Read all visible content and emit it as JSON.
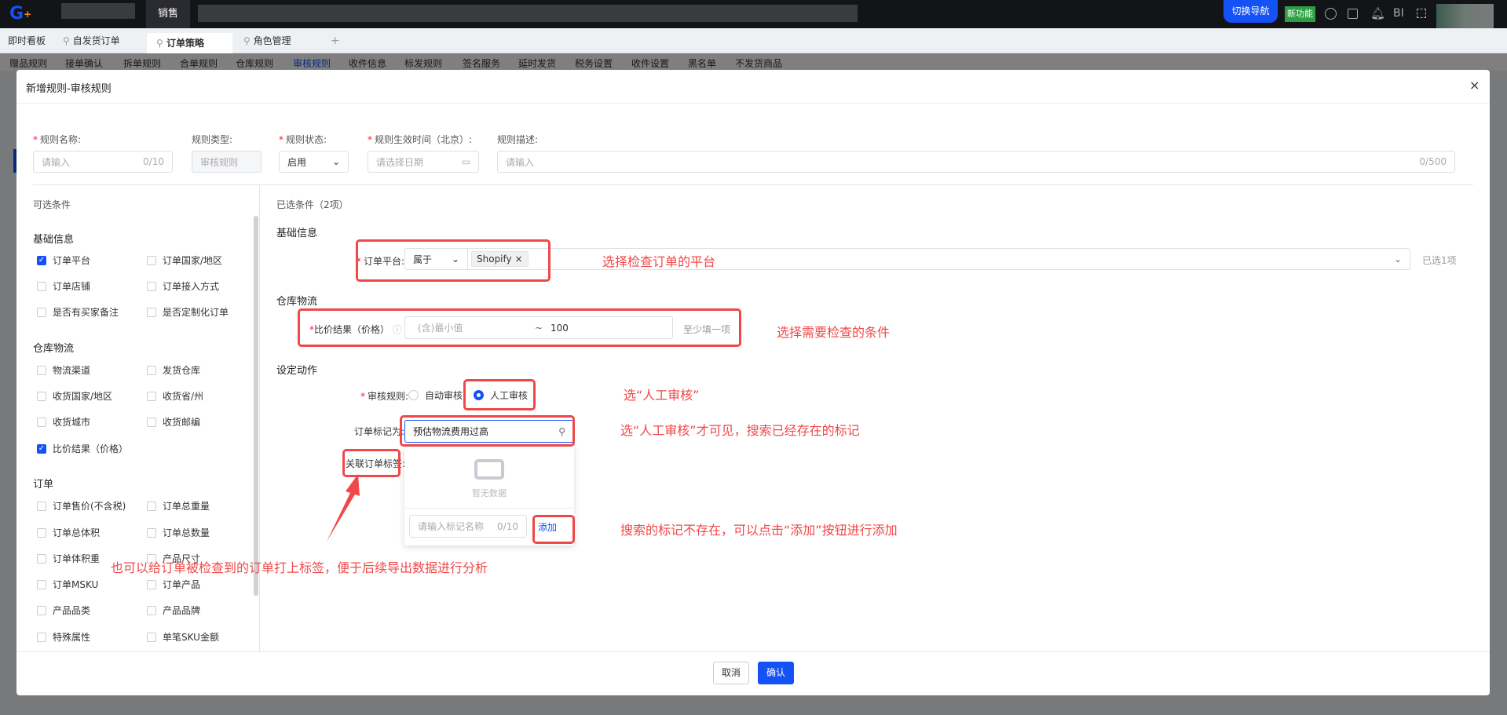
{
  "topbar": {
    "active_menu": "销售",
    "switch_nav": "切换导航",
    "new_feature": "新功能",
    "bi": "BI",
    "colors": {
      "bg": "#131418",
      "primary": "#1452f5",
      "green": "#2ea043"
    }
  },
  "tabs": [
    {
      "label": "即时看板"
    },
    {
      "label": "自发货订单"
    },
    {
      "label": "订单策略",
      "active": true
    },
    {
      "label": "角色管理"
    }
  ],
  "tab_add": "+",
  "subnav": [
    "赠品规则",
    "接单确认",
    "拆单规则",
    "合单规则",
    "仓库规则",
    "审核规则",
    "收件信息",
    "标发规则",
    "签名服务",
    "延时发货",
    "税务设置",
    "收件设置",
    "黑名单",
    "不发货商品"
  ],
  "modal": {
    "title": "新增规则-审核规则",
    "form": {
      "name_label": "规则名称:",
      "name_placeholder": "请输入",
      "name_count": "0/10",
      "type_label": "规则类型:",
      "type_value": "审核规则",
      "status_label": "规则状态:",
      "status_value": "启用",
      "time_label": "规则生效时间（北京）:",
      "time_placeholder": "请选择日期",
      "desc_label": "规则描述:",
      "desc_placeholder": "请输入",
      "desc_count": "0/500"
    },
    "left": {
      "title": "可选条件",
      "groups": [
        {
          "title": "基础信息",
          "items": [
            {
              "label": "订单平台",
              "checked": true
            },
            {
              "label": "订单国家/地区"
            },
            {
              "label": "订单店铺"
            },
            {
              "label": "订单接入方式"
            },
            {
              "label": "是否有买家备注"
            },
            {
              "label": "是否定制化订单"
            }
          ]
        },
        {
          "title": "仓库物流",
          "items": [
            {
              "label": "物流渠道"
            },
            {
              "label": "发货仓库"
            },
            {
              "label": "收货国家/地区"
            },
            {
              "label": "收货省/州"
            },
            {
              "label": "收货城市"
            },
            {
              "label": "收货邮编"
            },
            {
              "label": "比价结果（价格）",
              "checked": true
            }
          ]
        },
        {
          "title": "订单",
          "items": [
            {
              "label": "订单售价(不含税)"
            },
            {
              "label": "订单总重量"
            },
            {
              "label": "订单总体积"
            },
            {
              "label": "订单总数量"
            },
            {
              "label": "订单体积重"
            },
            {
              "label": "产品尺寸"
            },
            {
              "label": "订单MSKU"
            },
            {
              "label": "订单产品"
            },
            {
              "label": "产品品类"
            },
            {
              "label": "产品品牌"
            },
            {
              "label": "特殊属性"
            },
            {
              "label": "单笔SKU金额"
            }
          ]
        }
      ]
    },
    "right": {
      "title": "已选条件（2项）",
      "basic_title": "基础信息",
      "platform_label": "订单平台:",
      "platform_op": "属于",
      "platform_tag": "Shopify",
      "platform_selected": "已选1项",
      "wh_title": "仓库物流",
      "price_label": "比价结果（价格）",
      "price_min_placeholder": "(含)最小值",
      "price_sep": "~",
      "price_max": "100",
      "price_hint": "至少填一项",
      "action_title": "设定动作",
      "review_label": "审核规则:",
      "review_auto": "自动审核",
      "review_manual": "人工审核",
      "review_selected": "人工审核",
      "mark_label": "订单标记为:",
      "mark_value": "预估物流费用过高",
      "empty_text": "暂无数据",
      "new_mark_placeholder": "请输入标记名称",
      "new_mark_count": "0/10",
      "add_button": "添加",
      "tag_label": "关联订单标签:"
    },
    "footer": {
      "cancel": "取消",
      "confirm": "确认"
    }
  },
  "annotations": {
    "a1": "选择检查订单的平台",
    "a2": "选择需要检查的条件",
    "a3": "选“人工审核”",
    "a4": "选“人工审核”才可见，搜索已经存在的标记",
    "a5": "搜索的标记不存在，可以点击“添加”按钮进行添加",
    "a6": "也可以给订单被检查到的订单打上标签，便于后续导出数据进行分析"
  }
}
